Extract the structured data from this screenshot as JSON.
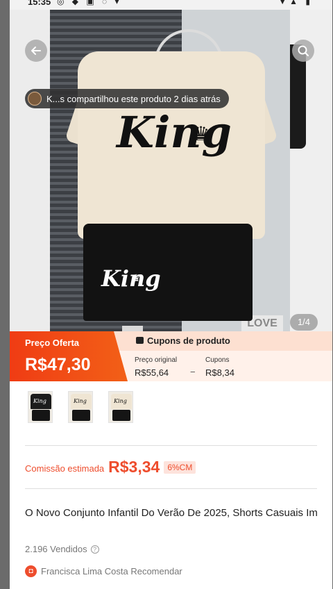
{
  "status_bar": {
    "time": "15:35"
  },
  "gallery": {
    "share_text": "K...s compartilhou este produto 2 dias atrás",
    "counter": "1/4",
    "print_text": "King",
    "wall_text": "LOVE"
  },
  "price": {
    "offer_label": "Preço Oferta",
    "offer_value": "R$47,30",
    "coupons_title": "Cupons de produto",
    "original_label": "Preço original",
    "original_value": "R$55,64",
    "coupon_label": "Cupons",
    "coupon_value": "R$8,34"
  },
  "thumbnails": [
    {
      "print_text": "King",
      "style": "dark"
    },
    {
      "print_text": "King",
      "style": "light"
    },
    {
      "print_text": "King",
      "style": "light"
    }
  ],
  "commission": {
    "label": "Comissão estimada",
    "value": "R$3,34",
    "badge": "6%CM"
  },
  "product": {
    "title": "O Novo Conjunto Infantil Do Verão De 2025, Shorts Casuais Im",
    "sold": "2.196 Vendidos",
    "recommender": "Francisca Lima Costa Recomendar"
  },
  "icons": {
    "back": "arrow-left-icon",
    "search": "search-icon",
    "help": "question-circle-icon",
    "shop": "shop-bag-icon",
    "coupon": "coupon-icon"
  },
  "colors": {
    "accent": "#ee4d2d",
    "offer_gradient_start": "#f03c14",
    "coupon_band": "#fff1ea"
  }
}
